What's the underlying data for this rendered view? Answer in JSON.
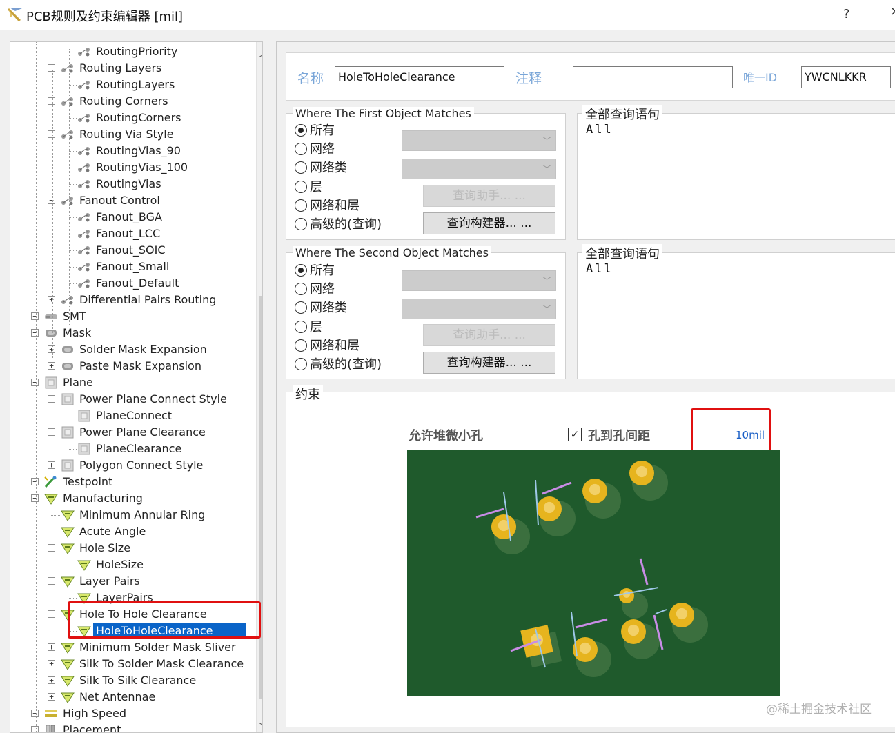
{
  "window": {
    "title": "PCB规则及约束编辑器 [mil]",
    "help": "?",
    "close": "×"
  },
  "tree": {
    "scroll_up": "︿",
    "scroll_down": "﹀",
    "items": [
      {
        "label": "RoutingPriority",
        "icon": "rule-routing-icon"
      },
      {
        "label": "Routing Layers",
        "icon": "rule-routing-icon",
        "expander": "−"
      },
      {
        "label": "RoutingLayers",
        "icon": "rule-routing-icon"
      },
      {
        "label": "Routing Corners",
        "icon": "rule-routing-icon",
        "expander": "−"
      },
      {
        "label": "RoutingCorners",
        "icon": "rule-routing-icon"
      },
      {
        "label": "Routing Via Style",
        "icon": "rule-routing-icon",
        "expander": "−"
      },
      {
        "label": "RoutingVias_90",
        "icon": "rule-routing-icon"
      },
      {
        "label": "RoutingVias_100",
        "icon": "rule-routing-icon"
      },
      {
        "label": "RoutingVias",
        "icon": "rule-routing-icon"
      },
      {
        "label": "Fanout Control",
        "icon": "rule-routing-icon",
        "expander": "−"
      },
      {
        "label": "Fanout_BGA",
        "icon": "rule-routing-icon"
      },
      {
        "label": "Fanout_LCC",
        "icon": "rule-routing-icon"
      },
      {
        "label": "Fanout_SOIC",
        "icon": "rule-routing-icon"
      },
      {
        "label": "Fanout_Small",
        "icon": "rule-routing-icon"
      },
      {
        "label": "Fanout_Default",
        "icon": "rule-routing-icon"
      },
      {
        "label": "Differential Pairs Routing",
        "icon": "rule-routing-icon",
        "expander": "+"
      },
      {
        "label": "SMT",
        "icon": "smt-icon",
        "expander": "+"
      },
      {
        "label": "Mask",
        "icon": "mask-icon",
        "expander": "−"
      },
      {
        "label": "Solder Mask Expansion",
        "icon": "mask-icon",
        "expander": "+"
      },
      {
        "label": "Paste Mask Expansion",
        "icon": "mask-icon",
        "expander": "+"
      },
      {
        "label": "Plane",
        "icon": "plane-icon",
        "expander": "−"
      },
      {
        "label": "Power Plane Connect Style",
        "icon": "plane-icon",
        "expander": "−"
      },
      {
        "label": "PlaneConnect",
        "icon": "plane-icon"
      },
      {
        "label": "Power Plane Clearance",
        "icon": "plane-icon",
        "expander": "−"
      },
      {
        "label": "PlaneClearance",
        "icon": "plane-icon"
      },
      {
        "label": "Polygon Connect Style",
        "icon": "plane-icon",
        "expander": "+"
      },
      {
        "label": "Testpoint",
        "icon": "testpoint-icon",
        "expander": "+"
      },
      {
        "label": "Manufacturing",
        "icon": "manufacturing-icon",
        "expander": "−"
      },
      {
        "label": "Minimum Annular Ring",
        "icon": "manufacturing-icon"
      },
      {
        "label": "Acute Angle",
        "icon": "manufacturing-icon"
      },
      {
        "label": "Hole Size",
        "icon": "manufacturing-icon",
        "expander": "−"
      },
      {
        "label": "HoleSize",
        "icon": "manufacturing-icon"
      },
      {
        "label": "Layer Pairs",
        "icon": "manufacturing-icon",
        "expander": "−"
      },
      {
        "label": "LayerPairs",
        "icon": "manufacturing-icon"
      },
      {
        "label": "Hole To Hole Clearance",
        "icon": "manufacturing-icon",
        "expander": "−"
      },
      {
        "label": "HoleToHoleClearance",
        "icon": "manufacturing-icon",
        "selected": true
      },
      {
        "label": "Minimum Solder Mask Sliver",
        "icon": "manufacturing-icon",
        "expander": "+"
      },
      {
        "label": "Silk To Solder Mask Clearance",
        "icon": "manufacturing-icon",
        "expander": "+"
      },
      {
        "label": "Silk To Silk Clearance",
        "icon": "manufacturing-icon",
        "expander": "+"
      },
      {
        "label": "Net Antennae",
        "icon": "manufacturing-icon",
        "expander": "+"
      },
      {
        "label": "High Speed",
        "icon": "highspeed-icon",
        "expander": "+"
      },
      {
        "label": "Placement",
        "icon": "placement-icon",
        "expander": "+"
      }
    ]
  },
  "rule": {
    "name_label": "名称",
    "name_value": "HoleToHoleClearance",
    "comment_label": "注释",
    "comment_value": "",
    "id_label": "唯一ID",
    "id_value": "YWCNLKKR"
  },
  "first_match": {
    "title": "Where The First Object Matches",
    "options": [
      "所有",
      "网络",
      "网络类",
      "层",
      "网络和层",
      "高级的(查询)"
    ],
    "selected": 0,
    "helper_button": "查询助手... ...",
    "builder_button": "查询构建器... ...",
    "query_title": "全部查询语句",
    "query_text": "All"
  },
  "second_match": {
    "title": "Where The Second Object Matches",
    "options": [
      "所有",
      "网络",
      "网络类",
      "层",
      "网络和层",
      "高级的(查询)"
    ],
    "selected": 0,
    "helper_button": "查询助手... ...",
    "builder_button": "查询构建器... ...",
    "query_title": "全部查询语句",
    "query_text": "All"
  },
  "constraints": {
    "title": "约束",
    "allow_stacked": "允许堆微小孔",
    "hole_clearance_label": "孔到孔间距",
    "hole_clearance_checked": true,
    "hole_clearance_value": "10mil"
  },
  "colors": {
    "board": "#1f5a2c",
    "pad": "#e6b41e",
    "arrow": "#c88ce6",
    "selection": "#0a64c8",
    "highlight": "#e01010"
  },
  "watermark": "@稀土掘金技术社区"
}
